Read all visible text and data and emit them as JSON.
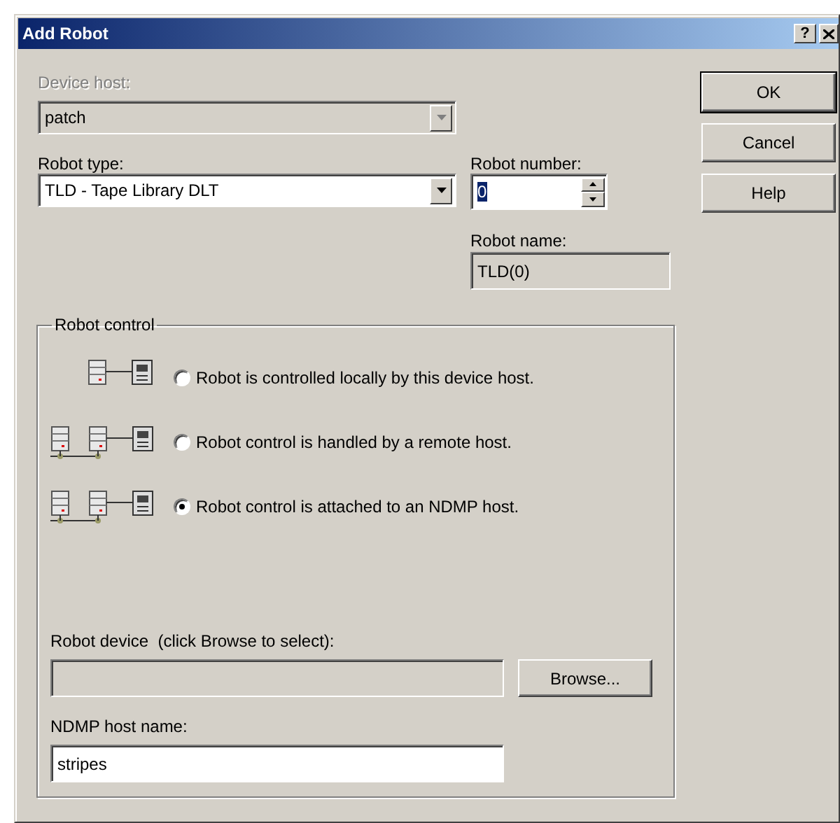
{
  "window": {
    "title": "Add Robot",
    "help_glyph": "?"
  },
  "device_host": {
    "label": "Device host:",
    "value": "patch",
    "disabled": true
  },
  "robot_type": {
    "label": "Robot type:",
    "value": "TLD - Tape Library DLT",
    "disabled": false
  },
  "robot_number": {
    "label": "Robot number:",
    "value": "0",
    "text_selected": true
  },
  "robot_name": {
    "label": "Robot name:",
    "value": "TLD(0)"
  },
  "buttons": [
    {
      "label": "OK",
      "default": true
    },
    {
      "label": "Cancel",
      "default": false
    },
    {
      "label": "Help",
      "default": false
    }
  ],
  "robot_control": {
    "title": "Robot control",
    "options": [
      {
        "kind": "local",
        "label": "Robot is controlled locally by this device host.",
        "selected": false
      },
      {
        "kind": "remote",
        "label": "Robot control is handled by a remote host.",
        "selected": false
      },
      {
        "kind": "remote",
        "label": "Robot control is attached to an NDMP host.",
        "selected": true
      }
    ]
  },
  "robot_device": {
    "label": "Robot device  (click Browse to select):",
    "disabled": true,
    "button": "Browse..."
  },
  "ndmp_host": {
    "label": "NDMP host name:",
    "value": "stripes",
    "disabled": false
  }
}
